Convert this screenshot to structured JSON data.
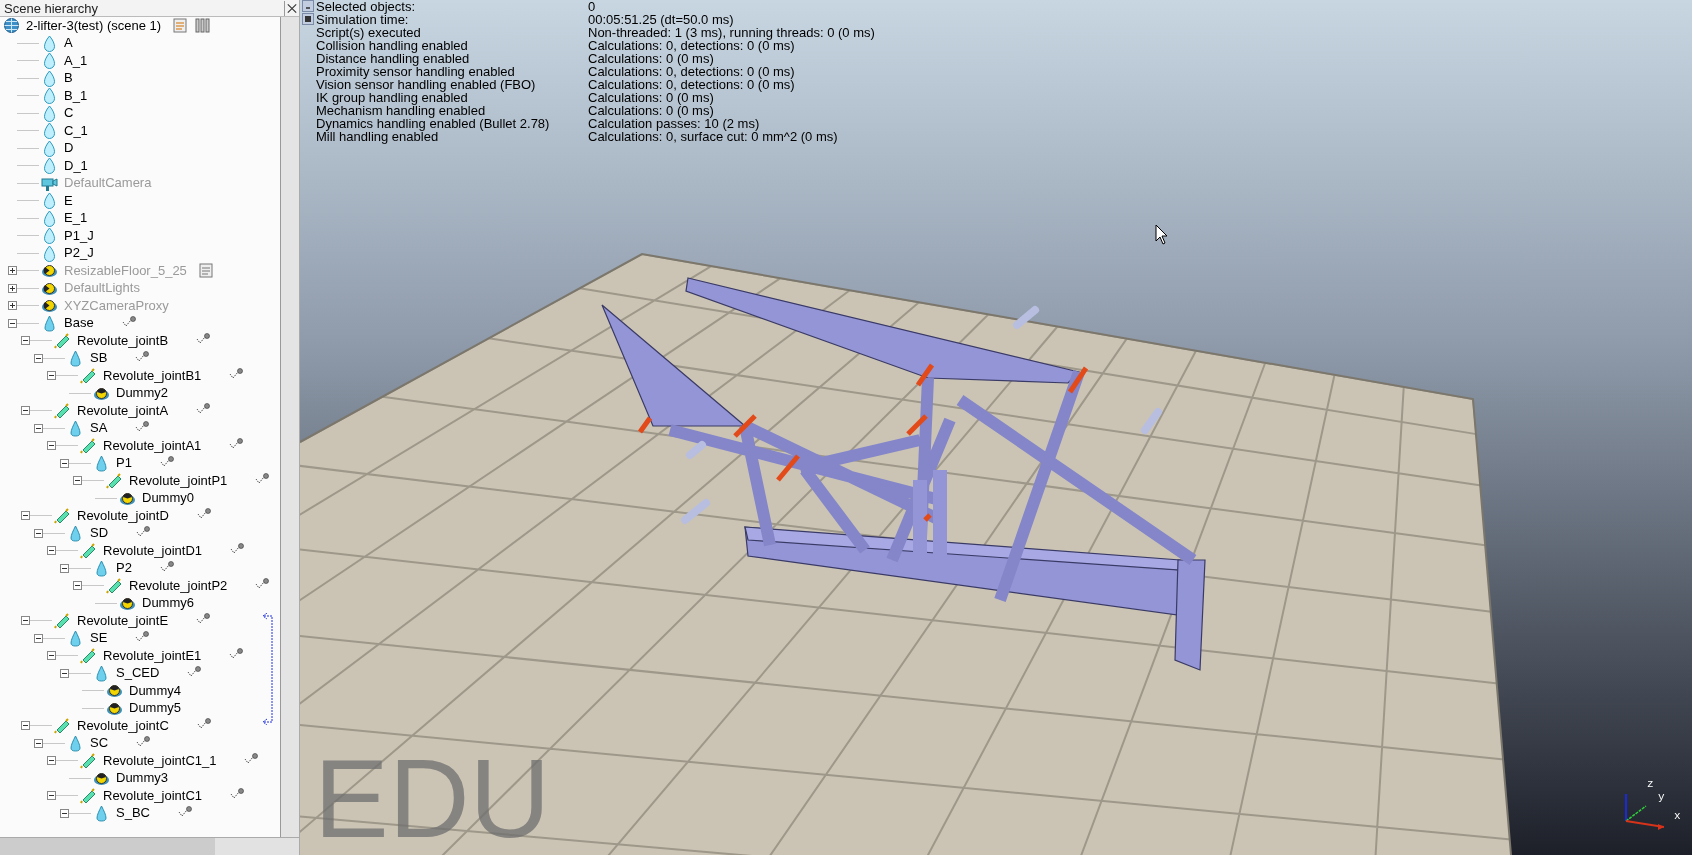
{
  "panel": {
    "title": "Scene hierarchy"
  },
  "tree": {
    "name": "2-lifter-3(test) (scene 1)",
    "kind": "scene",
    "dimmed": false,
    "script": true,
    "dynamic": false,
    "children": [
      {
        "name": "A",
        "kind": "shape",
        "dimmed": false,
        "script": false,
        "dynamic": false
      },
      {
        "name": "A_1",
        "kind": "shape",
        "dimmed": false,
        "script": false,
        "dynamic": false
      },
      {
        "name": "B",
        "kind": "shape",
        "dimmed": false,
        "script": false,
        "dynamic": false
      },
      {
        "name": "B_1",
        "kind": "shape",
        "dimmed": false,
        "script": false,
        "dynamic": false
      },
      {
        "name": "C",
        "kind": "shape",
        "dimmed": false,
        "script": false,
        "dynamic": false
      },
      {
        "name": "C_1",
        "kind": "shape",
        "dimmed": false,
        "script": false,
        "dynamic": false
      },
      {
        "name": "D",
        "kind": "shape",
        "dimmed": false,
        "script": false,
        "dynamic": false
      },
      {
        "name": "D_1",
        "kind": "shape",
        "dimmed": false,
        "script": false,
        "dynamic": false
      },
      {
        "name": "DefaultCamera",
        "kind": "camera",
        "dimmed": true,
        "script": false,
        "dynamic": false
      },
      {
        "name": "E",
        "kind": "shape",
        "dimmed": false,
        "script": false,
        "dynamic": false
      },
      {
        "name": "E_1",
        "kind": "shape",
        "dimmed": false,
        "script": false,
        "dynamic": false
      },
      {
        "name": "P1_J",
        "kind": "shape",
        "dimmed": false,
        "script": false,
        "dynamic": false
      },
      {
        "name": "P2_J",
        "kind": "shape",
        "dimmed": false,
        "script": false,
        "dynamic": false
      },
      {
        "name": "ResizableFloor_5_25",
        "kind": "model",
        "dimmed": true,
        "expanded": false,
        "script": true,
        "dynamic": false
      },
      {
        "name": "DefaultLights",
        "kind": "model",
        "dimmed": true,
        "expanded": false,
        "script": false,
        "dynamic": false
      },
      {
        "name": "XYZCameraProxy",
        "kind": "model",
        "dimmed": true,
        "expanded": false,
        "script": false,
        "dynamic": false
      },
      {
        "name": "Base",
        "kind": "cone",
        "dimmed": false,
        "expanded": true,
        "script": false,
        "dynamic": true,
        "children": [
          {
            "name": "Revolute_jointB",
            "kind": "joint",
            "dimmed": false,
            "expanded": true,
            "script": false,
            "dynamic": true,
            "children": [
              {
                "name": "SB",
                "kind": "cone",
                "dimmed": false,
                "expanded": true,
                "script": false,
                "dynamic": true,
                "children": [
                  {
                    "name": "Revolute_jointB1",
                    "kind": "joint",
                    "dimmed": false,
                    "expanded": true,
                    "script": false,
                    "dynamic": true,
                    "children": [
                      {
                        "name": "Dummy2",
                        "kind": "dummy",
                        "dimmed": false,
                        "script": false,
                        "dynamic": false
                      }
                    ]
                  }
                ]
              }
            ]
          },
          {
            "name": "Revolute_jointA",
            "kind": "joint",
            "dimmed": false,
            "expanded": true,
            "script": false,
            "dynamic": true,
            "children": [
              {
                "name": "SA",
                "kind": "cone",
                "dimmed": false,
                "expanded": true,
                "script": false,
                "dynamic": true,
                "children": [
                  {
                    "name": "Revolute_jointA1",
                    "kind": "joint",
                    "dimmed": false,
                    "expanded": true,
                    "script": false,
                    "dynamic": true,
                    "children": [
                      {
                        "name": "P1",
                        "kind": "cone",
                        "dimmed": false,
                        "expanded": true,
                        "script": false,
                        "dynamic": true,
                        "children": [
                          {
                            "name": "Revolute_jointP1",
                            "kind": "joint",
                            "dimmed": false,
                            "expanded": true,
                            "script": false,
                            "dynamic": true,
                            "children": [
                              {
                                "name": "Dummy0",
                                "kind": "dummy",
                                "dimmed": false,
                                "script": false,
                                "dynamic": false
                              }
                            ]
                          }
                        ]
                      }
                    ]
                  }
                ]
              }
            ]
          },
          {
            "name": "Revolute_jointD",
            "kind": "joint",
            "dimmed": false,
            "expanded": true,
            "script": false,
            "dynamic": true,
            "children": [
              {
                "name": "SD",
                "kind": "cone",
                "dimmed": false,
                "expanded": true,
                "script": false,
                "dynamic": true,
                "children": [
                  {
                    "name": "Revolute_jointD1",
                    "kind": "joint",
                    "dimmed": false,
                    "expanded": true,
                    "script": false,
                    "dynamic": true,
                    "children": [
                      {
                        "name": "P2",
                        "kind": "cone",
                        "dimmed": false,
                        "expanded": true,
                        "script": false,
                        "dynamic": true,
                        "children": [
                          {
                            "name": "Revolute_jointP2",
                            "kind": "joint",
                            "dimmed": false,
                            "expanded": true,
                            "script": false,
                            "dynamic": true,
                            "children": [
                              {
                                "name": "Dummy6",
                                "kind": "dummy",
                                "dimmed": false,
                                "script": false,
                                "dynamic": false
                              }
                            ]
                          }
                        ]
                      }
                    ]
                  }
                ]
              }
            ]
          },
          {
            "name": "Revolute_jointE",
            "kind": "joint",
            "dimmed": false,
            "expanded": true,
            "script": false,
            "dynamic": true,
            "children": [
              {
                "name": "SE",
                "kind": "cone",
                "dimmed": false,
                "expanded": true,
                "script": false,
                "dynamic": true,
                "children": [
                  {
                    "name": "Revolute_jointE1",
                    "kind": "joint",
                    "dimmed": false,
                    "expanded": true,
                    "script": false,
                    "dynamic": true,
                    "children": [
                      {
                        "name": "S_CED",
                        "kind": "cone",
                        "dimmed": false,
                        "expanded": true,
                        "script": false,
                        "dynamic": true,
                        "children": [
                          {
                            "name": "Dummy4",
                            "kind": "dummy",
                            "dimmed": false,
                            "script": false,
                            "dynamic": false
                          },
                          {
                            "name": "Dummy5",
                            "kind": "dummy",
                            "dimmed": false,
                            "script": false,
                            "dynamic": false
                          }
                        ]
                      }
                    ]
                  }
                ]
              }
            ]
          },
          {
            "name": "Revolute_jointC",
            "kind": "joint",
            "dimmed": false,
            "expanded": true,
            "script": false,
            "dynamic": true,
            "children": [
              {
                "name": "SC",
                "kind": "cone",
                "dimmed": false,
                "expanded": true,
                "script": false,
                "dynamic": true,
                "children": [
                  {
                    "name": "Revolute_jointC1_1",
                    "kind": "joint",
                    "dimmed": false,
                    "expanded": true,
                    "script": false,
                    "dynamic": true,
                    "children": [
                      {
                        "name": "Dummy3",
                        "kind": "dummy",
                        "dimmed": false,
                        "script": false,
                        "dynamic": false
                      }
                    ]
                  },
                  {
                    "name": "Revolute_jointC1",
                    "kind": "joint",
                    "dimmed": false,
                    "expanded": true,
                    "script": false,
                    "dynamic": true,
                    "children": [
                      {
                        "name": "S_BC",
                        "kind": "cone",
                        "dimmed": false,
                        "expanded": true,
                        "script": false,
                        "dynamic": true
                      }
                    ]
                  }
                ]
              }
            ]
          }
        ]
      }
    ]
  },
  "info": [
    {
      "label": "Selected objects:",
      "value": "0",
      "kind": "collapse"
    },
    {
      "label": "Simulation time:",
      "value": "00:05:51.25 (dt=50.0 ms)",
      "kind": "stop"
    },
    {
      "label": "Script(s) executed",
      "value": "Non-threaded: 1 (3 ms), running threads: 0 (0 ms)"
    },
    {
      "label": "Collision handling enabled",
      "value": "Calculations: 0, detections: 0 (0 ms)"
    },
    {
      "label": "Distance handling enabled",
      "value": "Calculations: 0 (0 ms)"
    },
    {
      "label": "Proximity sensor handling enabled",
      "value": "Calculations: 0, detections: 0 (0 ms)"
    },
    {
      "label": "Vision sensor handling enabled (FBO)",
      "value": "Calculations: 0, detections: 0 (0 ms)"
    },
    {
      "label": "IK group handling enabled",
      "value": "Calculations: 0 (0 ms)"
    },
    {
      "label": "Mechanism handling enabled",
      "value": "Calculations: 0 (0 ms)"
    },
    {
      "label": "Dynamics handling enabled (Bullet 2.78)",
      "value": "Calculation passes: 10 (2 ms)"
    },
    {
      "label": "Mill handling enabled",
      "value": "Calculations: 0, surface cut: 0 mm^2 (0 ms)"
    }
  ],
  "viewport": {
    "edition": "EDU",
    "axes": {
      "x": "x",
      "y": "y",
      "z": "z"
    }
  }
}
